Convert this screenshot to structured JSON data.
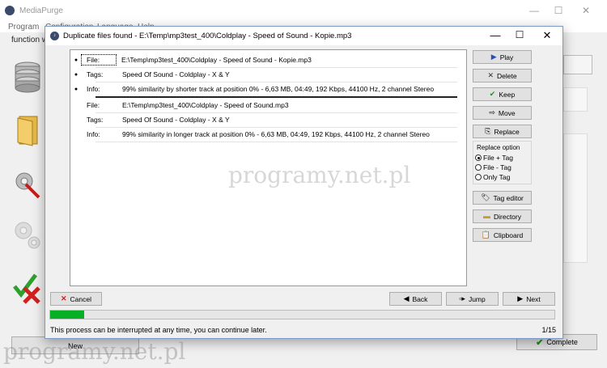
{
  "main": {
    "title": "MediaPurge",
    "menu": [
      "Program",
      "Configuration",
      "Language",
      "Help"
    ],
    "mode_label": "function w",
    "new_label": "New",
    "complete_label": "Complete"
  },
  "dialog": {
    "title": "Duplicate files found - E:\\Temp\\mp3test_400\\Coldplay - Speed of Sound - Kopie.mp3",
    "rows": [
      {
        "bullet": true,
        "label": "File:",
        "value": "E:\\Temp\\mp3test_400\\Coldplay - Speed of Sound - Kopie.mp3",
        "focused": true
      },
      {
        "bullet": true,
        "label": "Tags:",
        "value": "Speed Of Sound - Coldplay - X & Y",
        "focused": false
      },
      {
        "bullet": true,
        "label": "Info:",
        "value": "99% similarity by shorter track at position 0% - 6,63 MB, 04:49, 192 Kbps, 44100 Hz, 2 channel Stereo",
        "focused": false
      },
      {
        "bullet": false,
        "label": "File:",
        "value": "E:\\Temp\\mp3test_400\\Coldplay - Speed of Sound.mp3",
        "focused": false
      },
      {
        "bullet": false,
        "label": "Tags:",
        "value": "Speed Of Sound - Coldplay - X & Y",
        "focused": false
      },
      {
        "bullet": false,
        "label": "Info:",
        "value": "99% similarity in longer track at position 0% - 6,63 MB, 04:49, 192 Kbps, 44100 Hz, 2 channel Stereo",
        "focused": false
      }
    ],
    "buttons": {
      "play": "Play",
      "delete": "Delete",
      "keep": "Keep",
      "move": "Move",
      "replace": "Replace",
      "tag_editor": "Tag editor",
      "directory": "Directory",
      "clipboard": "Clipboard",
      "cancel": "Cancel",
      "back": "Back",
      "jump": "Jump",
      "next": "Next"
    },
    "replace_option": {
      "title": "Replace option",
      "options": [
        "File + Tag",
        "File - Tag",
        "Only Tag"
      ],
      "selected": "File + Tag"
    },
    "progress": 0.067,
    "status": "This process can be interrupted at any time, you can continue later.",
    "count": "1/15"
  },
  "watermark": "programy.net.pl",
  "colors": {
    "progress": "#06b025",
    "delete_icon": "#cc1f1f",
    "keep_icon": "#1f8f1f",
    "play_icon": "#2a4fb0"
  }
}
